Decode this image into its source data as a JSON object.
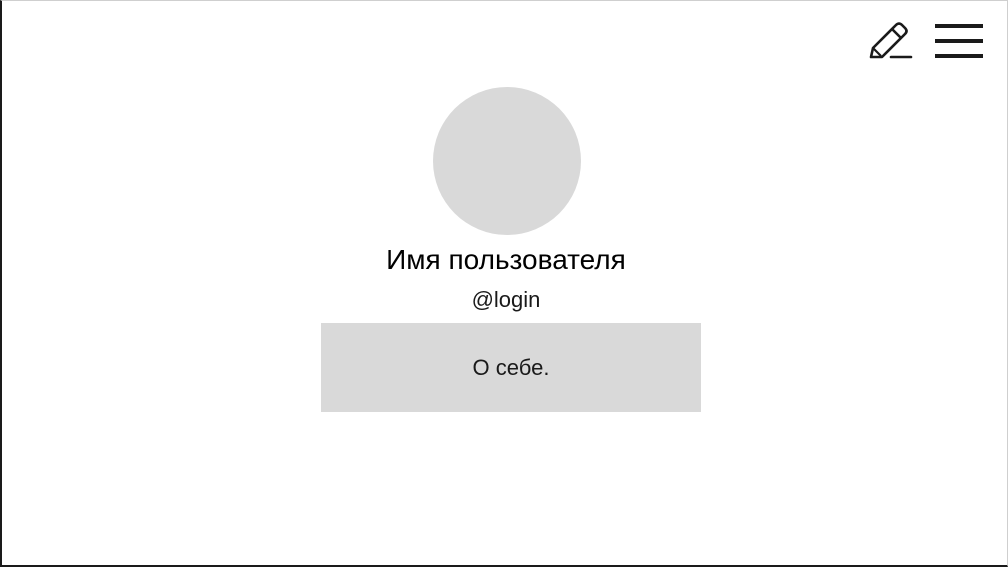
{
  "toolbar": {
    "edit_icon": "pencil-icon",
    "menu_icon": "hamburger-menu-icon"
  },
  "profile": {
    "display_name": "Имя пользователя",
    "login": "@login",
    "about": "О себе."
  },
  "colors": {
    "placeholder_fill": "#d9d9d9",
    "text": "#000000",
    "background": "#ffffff"
  }
}
